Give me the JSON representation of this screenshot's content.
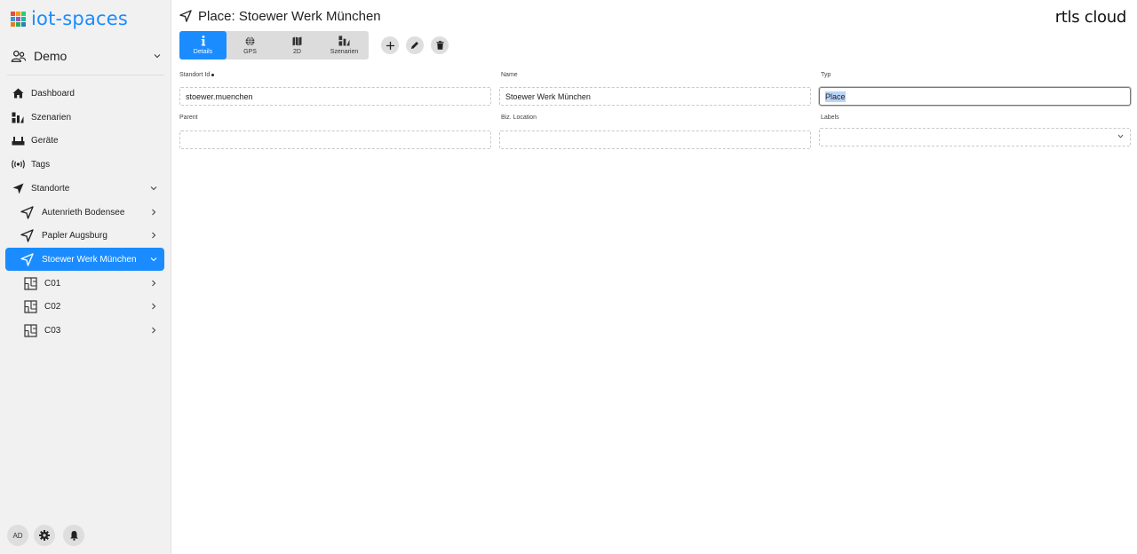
{
  "sidebar": {
    "logo_text": "iot-spaces",
    "logo_colors": [
      "#e74c3c",
      "#f39c12",
      "#2ecc71",
      "#3498db",
      "#9b59b6",
      "#1abc9c",
      "#e67e22",
      "#27ae60",
      "#2980b9"
    ],
    "account": {
      "label": "Demo",
      "icon": "users-icon"
    },
    "items": [
      {
        "label": "Dashboard",
        "icon": "home-icon"
      },
      {
        "label": "Szenarien",
        "icon": "scenarios-icon"
      },
      {
        "label": "Geräte",
        "icon": "devices-icon"
      },
      {
        "label": "Tags",
        "icon": "tag-signal-icon"
      },
      {
        "label": "Standorte",
        "icon": "location-arrow-icon"
      },
      {
        "label": "Autenrieth Bodensee",
        "icon": "location-arrow-icon"
      },
      {
        "label": "Papler Augsburg",
        "icon": "location-arrow-icon"
      },
      {
        "label": "Stoewer Werk München",
        "icon": "location-arrow-icon"
      },
      {
        "label": "C01",
        "icon": "floorplan-icon"
      },
      {
        "label": "C02",
        "icon": "floorplan-icon"
      },
      {
        "label": "C03",
        "icon": "floorplan-icon"
      }
    ],
    "bottom": {
      "avatar": "AD",
      "settings_icon": "gear-icon",
      "notifications_icon": "bell-icon"
    }
  },
  "header": {
    "title": "Place: Stoewer Werk München",
    "brand": "rtls cloud"
  },
  "tabs": [
    {
      "label": "Details",
      "icon": "info-icon"
    },
    {
      "label": "GPS",
      "icon": "globe-icon"
    },
    {
      "label": "2D",
      "icon": "map-icon"
    },
    {
      "label": "Szenarien",
      "icon": "scenarios-icon"
    }
  ],
  "actions": {
    "add_icon": "plus-icon",
    "edit_icon": "pencil-icon",
    "delete_icon": "trash-icon"
  },
  "form": {
    "standort_id": {
      "label": "Standort Id",
      "value": "stoewer.muenchen"
    },
    "name": {
      "label": "Name",
      "value": "Stoewer Werk München"
    },
    "typ": {
      "label": "Typ",
      "value": "Place"
    },
    "parent": {
      "label": "Parent",
      "value": ""
    },
    "biz_location": {
      "label": "Biz. Location",
      "value": ""
    },
    "labels": {
      "label": "Labels",
      "value": ""
    }
  },
  "colors": {
    "accent": "#1a8cff"
  }
}
